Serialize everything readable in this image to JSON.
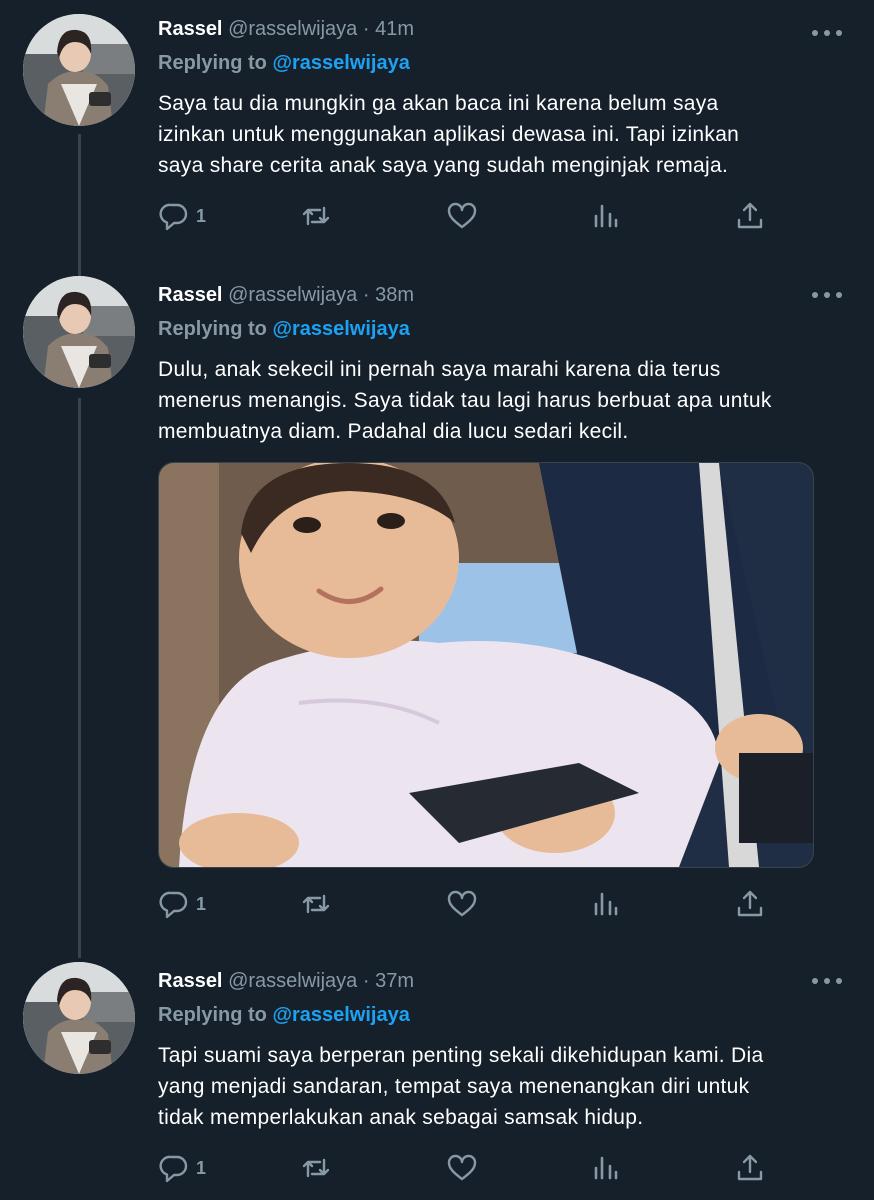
{
  "colors": {
    "background": "#15202b",
    "muted": "#8899a6",
    "accent": "#1da1f2",
    "thread_line": "#38444d"
  },
  "tweets": [
    {
      "name": "Rassel",
      "handle": "@rasselwijaya",
      "separator": "·",
      "time": "41m",
      "reply_prefix": "Replying to",
      "reply_to": "@rasselwijaya",
      "text_lines": [
        "Saya tau dia mungkin ga akan baca ini karena belum saya",
        "izinkan untuk menggunakan aplikasi dewasa ini. Tapi izinkan",
        "saya share cerita anak saya yang sudah menginjak remaja."
      ],
      "reply_count": "1",
      "icons": [
        "reply-icon",
        "retweet-icon",
        "like-icon",
        "analytics-icon",
        "share-icon"
      ]
    },
    {
      "name": "Rassel",
      "handle": "@rasselwijaya",
      "separator": "·",
      "time": "38m",
      "reply_prefix": "Replying to",
      "reply_to": "@rasselwijaya",
      "text_lines": [
        "Dulu, anak sekecil ini pernah saya marahi karena dia terus",
        "menerus menangis. Saya tidak tau lagi harus berbuat apa untuk",
        "membuatnya diam. Padahal dia lucu sedari kecil."
      ],
      "has_photo": true,
      "reply_count": "1",
      "icons": [
        "reply-icon",
        "retweet-icon",
        "like-icon",
        "analytics-icon",
        "share-icon"
      ]
    },
    {
      "name": "Rassel",
      "handle": "@rasselwijaya",
      "separator": "·",
      "time": "37m",
      "reply_prefix": "Replying to",
      "reply_to": "@rasselwijaya",
      "text_lines": [
        "Tapi suami saya berperan penting sekali dikehidupan kami. Dia",
        "yang menjadi sandaran, tempat saya menenangkan diri untuk",
        "tidak memperlakukan anak sebagai samsak hidup."
      ],
      "reply_count": "1",
      "icons": [
        "reply-icon",
        "retweet-icon",
        "like-icon",
        "analytics-icon",
        "share-icon"
      ]
    }
  ]
}
